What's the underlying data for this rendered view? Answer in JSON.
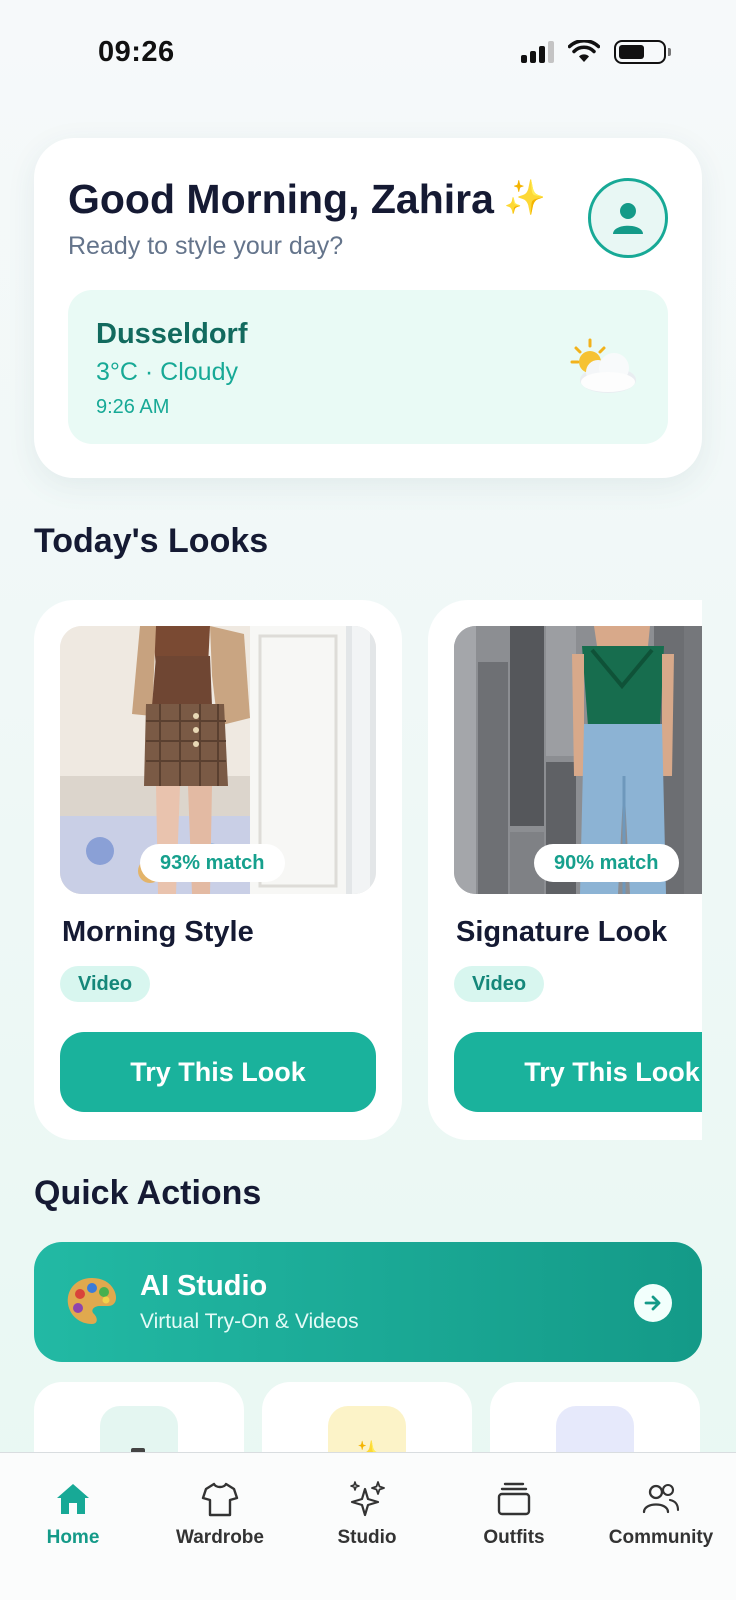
{
  "status_bar": {
    "time": "09:26"
  },
  "greeting": {
    "title": "Good Morning, Zahira",
    "subtitle": "Ready to style your day?"
  },
  "weather": {
    "city": "Dusseldorf",
    "condition": "3°C · Cloudy",
    "time": "9:26 AM"
  },
  "sections": {
    "looks_title": "Today's Looks",
    "quick_actions_title": "Quick Actions"
  },
  "looks": [
    {
      "match": "93% match",
      "name": "Morning Style",
      "tag": "Video",
      "button": "Try This Look"
    },
    {
      "match": "90% match",
      "name": "Signature Look",
      "tag": "Video",
      "button": "Try This Look"
    }
  ],
  "ai_studio": {
    "title": "AI Studio",
    "subtitle": "Virtual Try-On & Videos"
  },
  "quick_actions_tiles": [
    {
      "icon": "camera-icon"
    },
    {
      "icon": "sparkle-icon"
    },
    {
      "icon": "community-icon"
    }
  ],
  "nav": {
    "items": [
      {
        "label": "Home",
        "icon": "home-icon",
        "active": true
      },
      {
        "label": "Wardrobe",
        "icon": "shirt-icon",
        "active": false
      },
      {
        "label": "Studio",
        "icon": "sparkles-icon",
        "active": false
      },
      {
        "label": "Outfits",
        "icon": "stack-icon",
        "active": false
      },
      {
        "label": "Community",
        "icon": "people-icon",
        "active": false
      }
    ]
  },
  "colors": {
    "accent": "#1ab29c",
    "accent_dark": "#149a88",
    "title_text": "#151a33",
    "weather_bg": "#e9faf5"
  }
}
